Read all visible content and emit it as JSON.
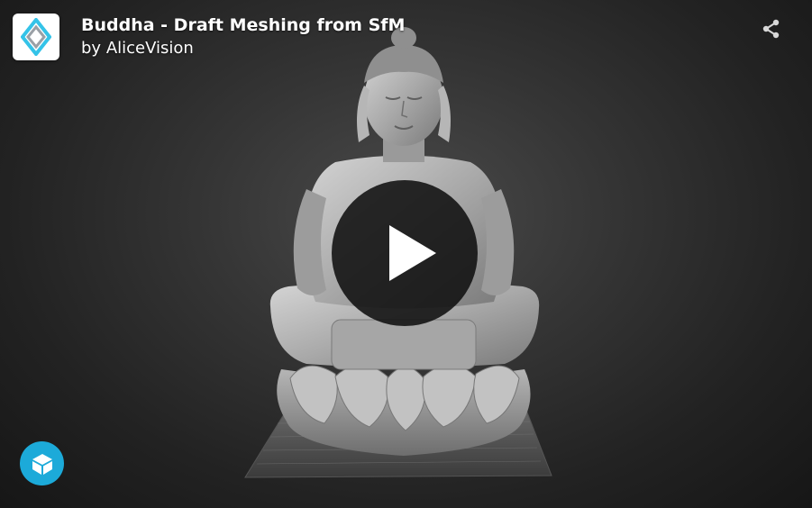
{
  "model": {
    "title": "Buddha - Draft Meshing from SfM",
    "byline_prefix": "by",
    "author": "AliceVision"
  },
  "icons": {
    "logo": "alicevision-logo-icon",
    "share": "share-icon",
    "play": "play-icon",
    "badge": "sketchfab-cube-icon"
  },
  "colors": {
    "background": "#2b2b2b",
    "badge": "#1caad9",
    "play_button": "#101010",
    "text": "#ffffff"
  }
}
